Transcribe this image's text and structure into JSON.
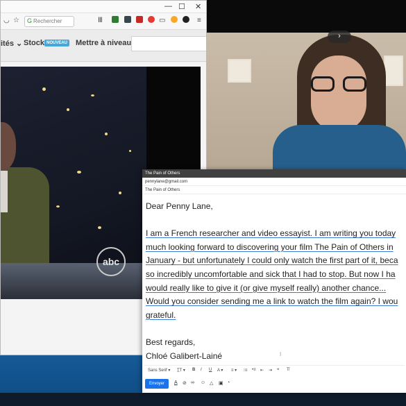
{
  "browser": {
    "window_controls": {
      "minimize": "—",
      "maximize": "☐",
      "close": "✕"
    },
    "toolbar": {
      "search_placeholder": "Rechercher"
    },
    "nav": {
      "item1": "ités ⌄",
      "item2": "Stock",
      "badge": "NOUVEAU",
      "item3": "Mettre à niveau"
    },
    "video": {
      "logo": "abc"
    }
  },
  "call": {
    "expand_glyph": "›"
  },
  "compose": {
    "title": "The Pain of Others",
    "to": "pennylane@gmail.com",
    "subject": "The Pain of Others",
    "body": {
      "greeting": "Dear Penny Lane,",
      "line1": "I am a French researcher and video essayist. I am writing you today",
      "line2_pre": "much looking forward to discovering your film ",
      "line2_link": "The Pain of Others",
      "line2_post": " in",
      "line3": "January - but unfortunately I could only watch the first part of it, beca",
      "line4": "so incredibly uncomfortable and sick that I had to stop. But now I ha",
      "line5": "would really like to give it (or give myself really) another chance...",
      "line6": "Would you consider sending me a link to watch the film again? I wou",
      "line7": "grateful.",
      "closing": "Best regards,",
      "signature": "Chloé Galibert-Lainé"
    },
    "format_bar": {
      "font": "Sans Serif ▾",
      "size": "T̲T ▾",
      "bold": "B",
      "italic": "I",
      "underline": "U",
      "color": "A ▾",
      "align": "≡ ▾",
      "numbered": "⁝≡",
      "bulleted": "•≡",
      "indent_less": "⇤",
      "indent_more": "⇥",
      "quote": "❝",
      "clear": "T̸"
    },
    "send_label": "Envoyer"
  }
}
